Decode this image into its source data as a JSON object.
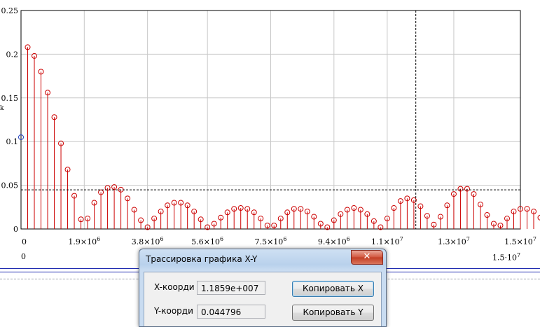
{
  "chart_data": {
    "type": "stem",
    "xlim": [
      0,
      15000000
    ],
    "ylim": [
      0,
      0.25
    ],
    "x_tick_values": [
      0,
      1900000,
      3800000,
      5600000,
      7500000,
      9400000,
      11000000,
      13000000,
      15000000
    ],
    "x_tick_labels": [
      "0",
      "1.9×10^6",
      "3.8×10^6",
      "5.6×10^6",
      "7.5×10^6",
      "9.4×10^6",
      "1.1×10^7",
      "1.3×10^7",
      "1.5×10^7"
    ],
    "y_tick_values": [
      0,
      0.05,
      0.1,
      0.15,
      0.2,
      0.25
    ],
    "y_tick_labels": [
      "0",
      "0.05",
      "0.1",
      "0.15",
      "0.2",
      "0.25"
    ],
    "ylabel": "k",
    "grid": true,
    "stem_color": "#cc0000",
    "marker_color": "#cc0000",
    "first_point": {
      "x": 0,
      "y": 0.105,
      "color": "#1f3fbf"
    },
    "x_step": 200000,
    "values": [
      0.208,
      0.198,
      0.18,
      0.156,
      0.128,
      0.098,
      0.068,
      0.038,
      0.011,
      0.012,
      0.03,
      0.042,
      0.047,
      0.048,
      0.045,
      0.035,
      0.022,
      0.01,
      0.002,
      0.012,
      0.02,
      0.027,
      0.03,
      0.03,
      0.027,
      0.02,
      0.011,
      0.002,
      0.006,
      0.013,
      0.019,
      0.023,
      0.024,
      0.023,
      0.019,
      0.012,
      0.004,
      0.004,
      0.012,
      0.019,
      0.023,
      0.023,
      0.02,
      0.014,
      0.006,
      0.002,
      0.01,
      0.017,
      0.022,
      0.024,
      0.022,
      0.017,
      0.009,
      0.002,
      0.012,
      0.024,
      0.032,
      0.035,
      0.033,
      0.026,
      0.015,
      0.005,
      0.014,
      0.027,
      0.04,
      0.046,
      0.046,
      0.04,
      0.028,
      0.016,
      0.006,
      0.004,
      0.012,
      0.02,
      0.023,
      0.023,
      0.02,
      0.013,
      0.006,
      0.003,
      0.008,
      0.011,
      0.012
    ],
    "crosshair": {
      "x": 11859000,
      "y": 0.044796
    },
    "extra_labels": {
      "x_left": "0",
      "x_right": "1.5·10^7"
    }
  },
  "dialog": {
    "title": "Трассировка графика X-Y",
    "close_glyph": "✕",
    "x_label": "X-коорди",
    "x_value": "1.1859e+007",
    "y_label": "Y-коорди",
    "y_value": "0.044796",
    "copy_x": "Копировать X",
    "copy_y": "Копировать Y"
  }
}
